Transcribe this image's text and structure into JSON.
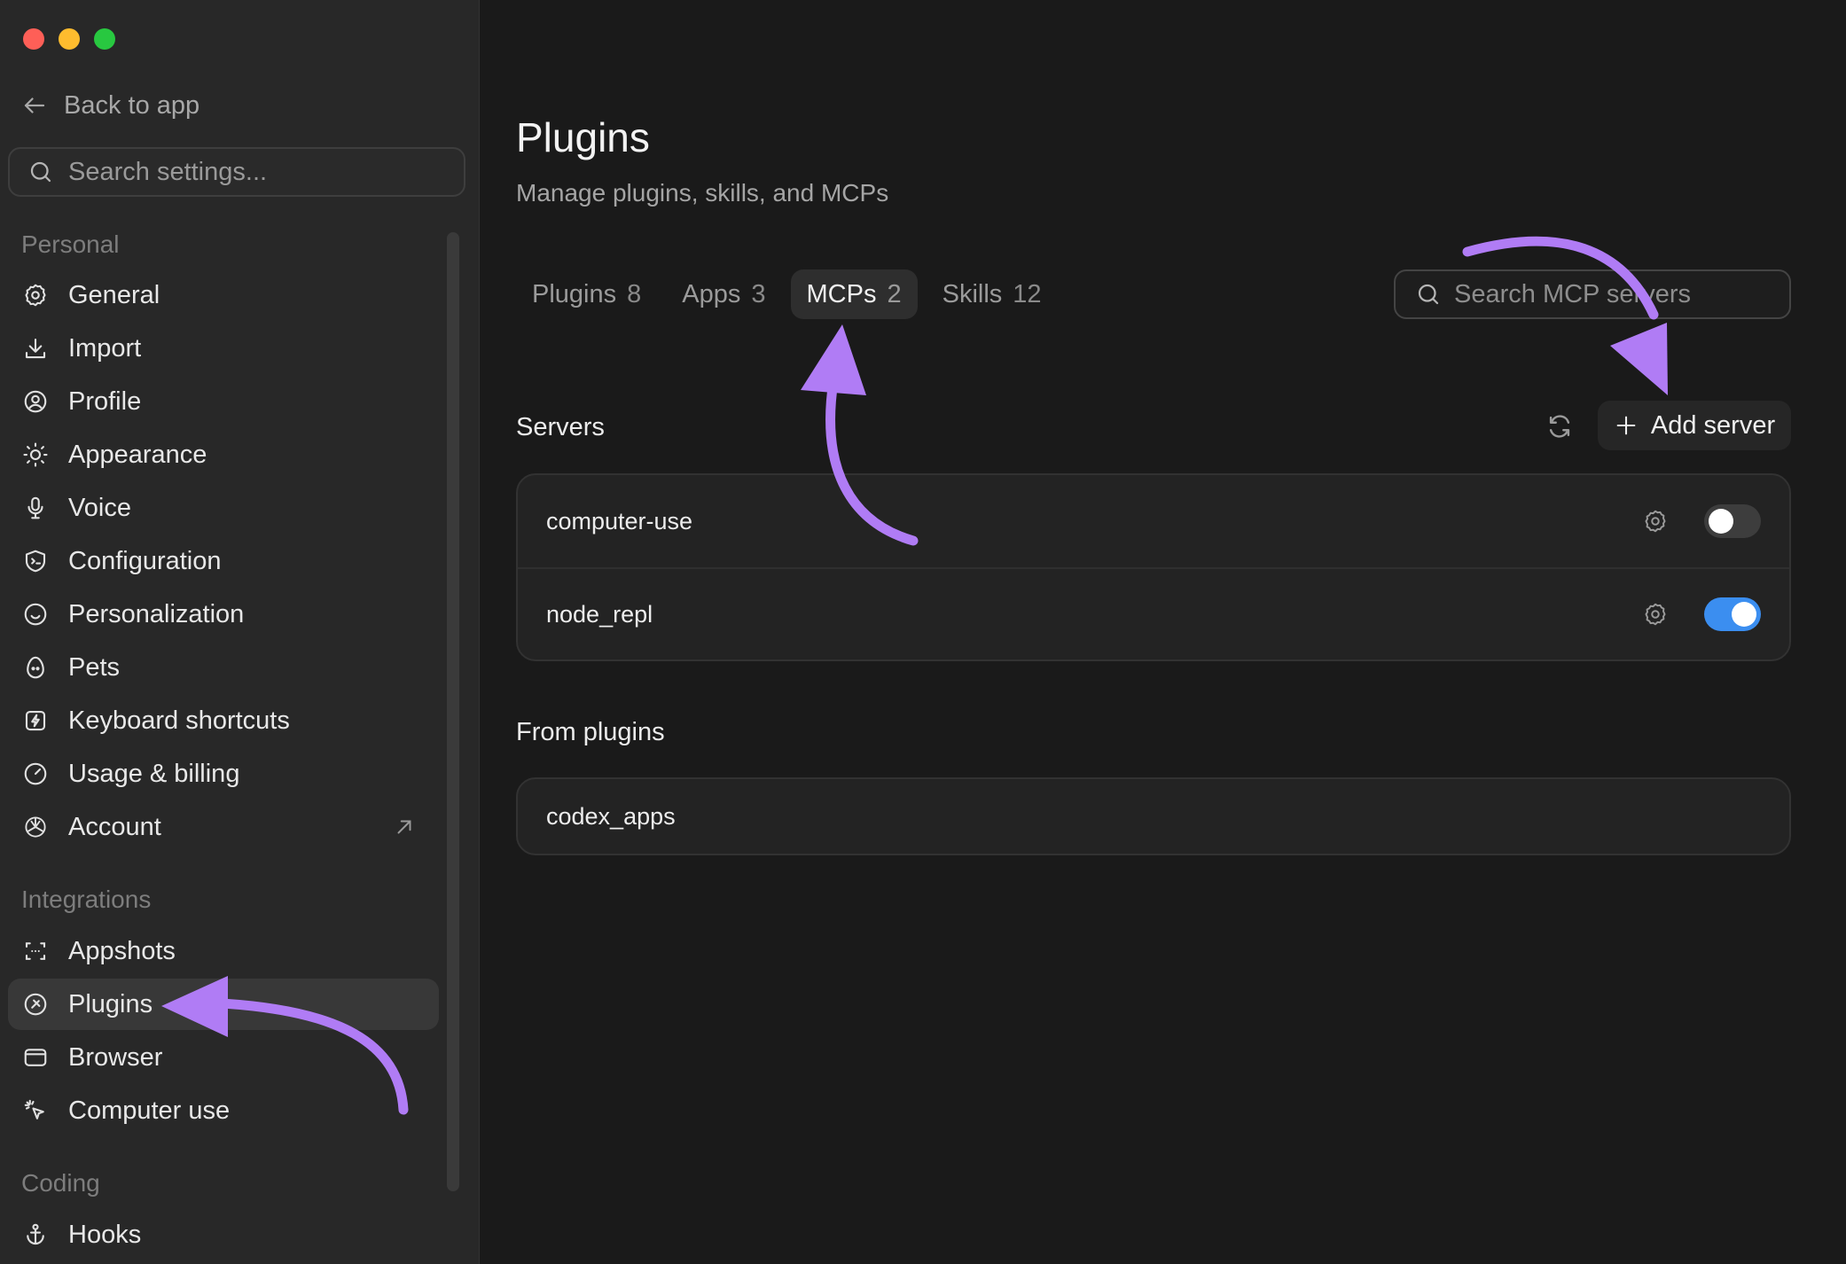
{
  "sidebar": {
    "back_label": "Back to app",
    "search_placeholder": "Search settings...",
    "sections": {
      "personal": "Personal",
      "integrations": "Integrations",
      "coding": "Coding"
    },
    "personal_items": [
      {
        "label": "General",
        "icon": "gear-icon"
      },
      {
        "label": "Import",
        "icon": "download-icon"
      },
      {
        "label": "Profile",
        "icon": "user-circle-icon"
      },
      {
        "label": "Appearance",
        "icon": "sun-icon"
      },
      {
        "label": "Voice",
        "icon": "microphone-icon"
      },
      {
        "label": "Configuration",
        "icon": "shield-terminal-icon"
      },
      {
        "label": "Personalization",
        "icon": "smile-icon"
      },
      {
        "label": "Pets",
        "icon": "egg-icon"
      },
      {
        "label": "Keyboard shortcuts",
        "icon": "bolt-square-icon"
      },
      {
        "label": "Usage & billing",
        "icon": "gauge-icon"
      },
      {
        "label": "Account",
        "icon": "openai-logo-icon"
      }
    ],
    "integration_items": [
      {
        "label": "Appshots",
        "icon": "screenshot-frame-icon"
      },
      {
        "label": "Plugins",
        "icon": "plug-circle-icon",
        "active": true
      },
      {
        "label": "Browser",
        "icon": "browser-window-icon"
      },
      {
        "label": "Computer use",
        "icon": "cursor-click-icon"
      }
    ],
    "coding_items": [
      {
        "label": "Hooks",
        "icon": "anchor-icon"
      }
    ]
  },
  "main": {
    "title": "Plugins",
    "subtitle": "Manage plugins, skills, and MCPs",
    "tabs": [
      {
        "label": "Plugins",
        "count": "8"
      },
      {
        "label": "Apps",
        "count": "3"
      },
      {
        "label": "MCPs",
        "count": "2",
        "active": true
      },
      {
        "label": "Skills",
        "count": "12"
      }
    ],
    "search_placeholder": "Search MCP servers",
    "servers_heading": "Servers",
    "add_server_label": "Add server",
    "servers": [
      {
        "name": "computer-use",
        "enabled": false
      },
      {
        "name": "node_repl",
        "enabled": true
      }
    ],
    "from_plugins_heading": "From plugins",
    "plugin_servers": [
      {
        "name": "codex_apps"
      }
    ]
  },
  "colors": {
    "accent_toggle": "#3b8ef0",
    "annotation_arrow": "#b07cf5",
    "traffic_close": "#fe5f57",
    "traffic_min": "#febc2e",
    "traffic_max": "#28c840"
  }
}
